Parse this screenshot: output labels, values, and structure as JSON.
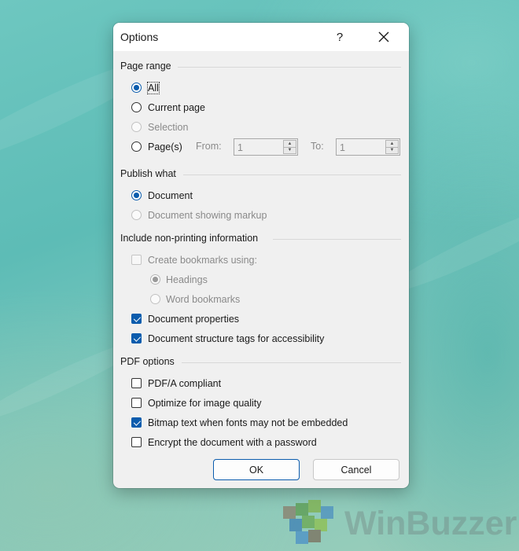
{
  "dialog": {
    "title": "Options",
    "help_label": "?",
    "close_icon": "close-icon"
  },
  "page_range": {
    "heading": "Page range",
    "all": "All",
    "current_page": "Current page",
    "selection": "Selection",
    "pages": "Page(s)",
    "from_label": "From:",
    "from_value": "1",
    "to_label": "To:",
    "to_value": "1",
    "selected": "All"
  },
  "publish_what": {
    "heading": "Publish what",
    "document": "Document",
    "document_markup": "Document showing markup",
    "selected": "Document"
  },
  "non_printing": {
    "heading": "Include non-printing information",
    "create_bookmarks": "Create bookmarks using:",
    "create_bookmarks_checked": false,
    "headings": "Headings",
    "word_bookmarks": "Word bookmarks",
    "document_properties": "Document properties",
    "document_properties_checked": true,
    "structure_tags": "Document structure tags for accessibility",
    "structure_tags_checked": true
  },
  "pdf_options": {
    "heading": "PDF options",
    "pdfa": "PDF/A compliant",
    "pdfa_checked": false,
    "optimize_image": "Optimize for image quality",
    "optimize_image_checked": false,
    "bitmap_text": "Bitmap text when fonts may not be embedded",
    "bitmap_text_checked": true,
    "encrypt": "Encrypt the document with a password",
    "encrypt_checked": false
  },
  "buttons": {
    "ok": "OK",
    "cancel": "Cancel"
  },
  "watermark": {
    "text": "WinBuzzer"
  },
  "colors": {
    "accent": "#0b5cad",
    "dialog_bg": "#f0f0f0"
  }
}
